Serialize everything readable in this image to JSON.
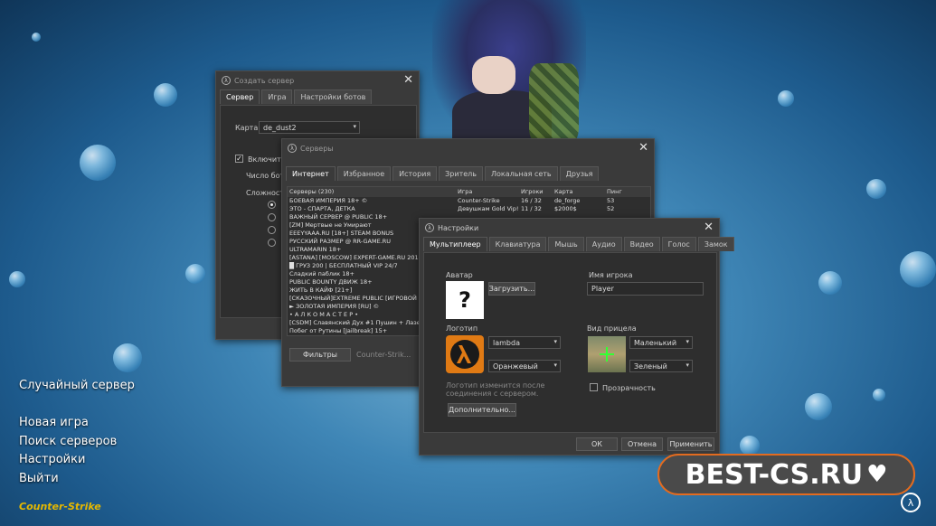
{
  "main_menu": {
    "items": [
      "Случайный сервер",
      "Новая игра",
      "Поиск серверов",
      "Настройки",
      "Выйти"
    ],
    "logo_text": "Counter-Strike"
  },
  "watermark": "BEST-CS.RU",
  "create_server": {
    "title": "Создать сервер",
    "tabs": [
      "Сервер",
      "Игра",
      "Настройки ботов"
    ],
    "map_label": "Карта",
    "map_value": "de_dust2",
    "enable_label": "Включить",
    "bot_count_label": "Число бот",
    "difficulty_label": "Сложность"
  },
  "servers": {
    "title": "Серверы",
    "tabs": [
      "Интернет",
      "Избранное",
      "История",
      "Зритель",
      "Локальная сеть",
      "Друзья"
    ],
    "columns": [
      "Серверы (230)",
      "Игра",
      "Игроки",
      "Карта",
      "Пинг"
    ],
    "rows": [
      [
        "БОЕВАЯ ИМПЕРИЯ 18+ ©",
        "Counter-Strike",
        "16 / 32",
        "de_forge",
        "53"
      ],
      [
        "ЭТО - СПАРТА, ДЕТКА",
        "Девушкам Gold Vip!",
        "11 / 32",
        "$2000$",
        "52"
      ],
      [
        "ВАЖНЫЙ СЕРВЕР @ PUBLIC 18+",
        "",
        "",
        "",
        ""
      ],
      [
        "[ZM] Мертвые не Умирают",
        "",
        "",
        "",
        ""
      ],
      [
        "EEEYYAAA.RU [18+] STEAM BONUS",
        "",
        "",
        "",
        ""
      ],
      [
        "РУССКИЙ РАЗМЕР @ RR-GAME.RU",
        "",
        "",
        "",
        ""
      ],
      [
        "ULTRAMARIN 18+",
        "",
        "",
        "",
        ""
      ],
      [
        "[ASTANA] [MOSCOW] EXPERT-GAME.RU 2015-2",
        "",
        "",
        "",
        ""
      ],
      [
        "█ ГРУЗ 200 | БЕСПЛАТНЫЙ VIP 24/7",
        "",
        "",
        "",
        ""
      ],
      [
        "Сладкий паблик 18+",
        "",
        "",
        "",
        ""
      ],
      [
        "PUBLIC BOUNTY ДВИЖ 18+",
        "",
        "",
        "",
        ""
      ],
      [
        "ЖИТЬ В КАЙФ [21+]",
        "",
        "",
        "",
        ""
      ],
      [
        "[СКАЗОЧНЫЙ]EXTREME PUBLIC [ИГРОВОЙ ВАЛ",
        "",
        "",
        "",
        ""
      ],
      [
        "► ЗОЛОТАЯ ИМПЕРИЯ [RU] ©",
        "",
        "",
        "",
        ""
      ],
      [
        "• А Л К О М А С Т Е Р •",
        "",
        "",
        "",
        ""
      ],
      [
        "[CSDM] Славянский Дух #1 Пушин + Лазеры",
        "",
        "",
        "",
        ""
      ],
      [
        "Побег от Рутины [Jailbreak] 15+",
        "",
        "",
        "",
        ""
      ]
    ],
    "filter_button": "Фильтры",
    "filter_value": "Counter-Strik..."
  },
  "settings": {
    "title": "Настройки",
    "tabs": [
      "Мультиплеер",
      "Клавиатура",
      "Мышь",
      "Аудио",
      "Видео",
      "Голос",
      "Замок"
    ],
    "avatar_label": "Аватар",
    "avatar_placeholder": "?",
    "upload_button": "Загрузить...",
    "player_name_label": "Имя игрока",
    "player_name_value": "Player",
    "logo_label": "Логотип",
    "logo_value": "lambda",
    "logo_color": "Оранжевый",
    "logo_note": "Логотип изменится после соединения с сервером.",
    "advanced_button": "Дополнительно...",
    "crosshair_label": "Вид прицела",
    "crosshair_size": "Маленький",
    "crosshair_color": "Зеленый",
    "transparency_label": "Прозрачность",
    "ok_button": "ОК",
    "cancel_button": "Отмена",
    "apply_button": "Применить"
  },
  "colors": {
    "accent": "#e36b1f",
    "window": "#3a3a3a",
    "logo_bg": "#e07a14"
  }
}
